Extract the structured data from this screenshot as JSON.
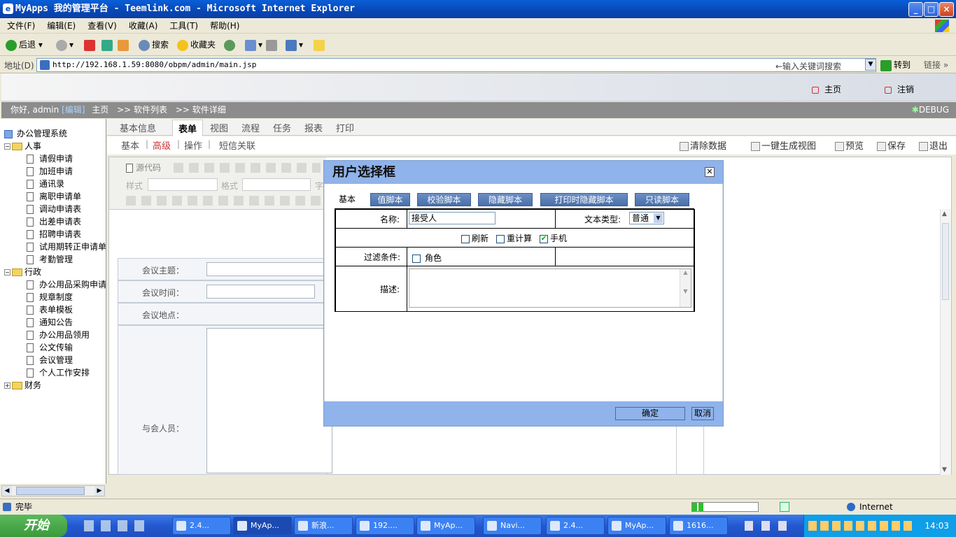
{
  "window": {
    "title": "MyApps 我的管理平台 - Teemlink.com - Microsoft Internet Explorer",
    "min": "_",
    "max": "□",
    "close": "×"
  },
  "menu": [
    "文件(F)",
    "编辑(E)",
    "查看(V)",
    "收藏(A)",
    "工具(T)",
    "帮助(H)"
  ],
  "toolbar": {
    "back": "后退",
    "search": "搜索",
    "favorites": "收藏夹"
  },
  "address": {
    "label": "地址(D)",
    "url": "http://192.168.1.59:8080/obpm/admin/main.jsp",
    "search_hint": "←输入关键词搜索",
    "go": "转到",
    "links": "链接"
  },
  "header": {
    "home": "主页",
    "logout": "注销"
  },
  "crumb": {
    "greet": "你好, admin",
    "edit": "[编辑]",
    "home": "主页",
    "path1": ">> 软件列表",
    "path2": ">> 软件详细",
    "debug": "DEBUG"
  },
  "tree": {
    "root": "办公管理系统",
    "groups": [
      {
        "name": "人事",
        "items": [
          "请假申请",
          "加班申请",
          "通讯录",
          "离职申请单",
          "调动申请表",
          "出差申请表",
          "招聘申请表",
          "试用期转正申请单",
          "考勤管理"
        ]
      },
      {
        "name": "行政",
        "items": [
          "办公用品采购申请",
          "规章制度",
          "表单模板",
          "通知公告",
          "办公用品领用",
          "公文传输",
          "会议管理",
          "个人工作安排"
        ]
      },
      {
        "name": "财务",
        "items": []
      }
    ]
  },
  "tabs1": [
    "基本信息",
    "表单",
    "视图",
    "流程",
    "任务",
    "报表",
    "打印"
  ],
  "tabs2": [
    "基本",
    "高级",
    "操作",
    "短信关联"
  ],
  "actions": [
    "清除数据",
    "一键生成视图",
    "预览",
    "保存",
    "退出"
  ],
  "editor": {
    "source": "源代码",
    "style": "样式",
    "format": "格式",
    "font": "字",
    "fields": [
      "会议主题：",
      "会议时间：",
      "会议地点：",
      "与会人员："
    ]
  },
  "dialog": {
    "title": "用户选择框",
    "tabs": [
      "基本",
      "值脚本",
      "校验脚本",
      "隐藏脚本",
      "打印时隐藏脚本",
      "只读脚本"
    ],
    "name_label": "名称:",
    "name_value": "接受人",
    "type_label": "文本类型:",
    "type_value": "普通",
    "checks": [
      {
        "label": "刷新",
        "checked": false
      },
      {
        "label": "重计算",
        "checked": false
      },
      {
        "label": "手机",
        "checked": true
      }
    ],
    "filter_label": "过滤条件:",
    "role_label": "角色",
    "desc_label": "描述:",
    "ok": "确定",
    "cancel": "取消"
  },
  "status": {
    "done": "完毕",
    "zone": "Internet"
  },
  "taskbar": {
    "start": "开始",
    "tasks": [
      "2.4...",
      "MyAp...",
      "新浪...",
      "192....",
      "MyAp...",
      "Navi...",
      "2.4...",
      "MyAp...",
      "1616..."
    ],
    "time": "14:03"
  }
}
